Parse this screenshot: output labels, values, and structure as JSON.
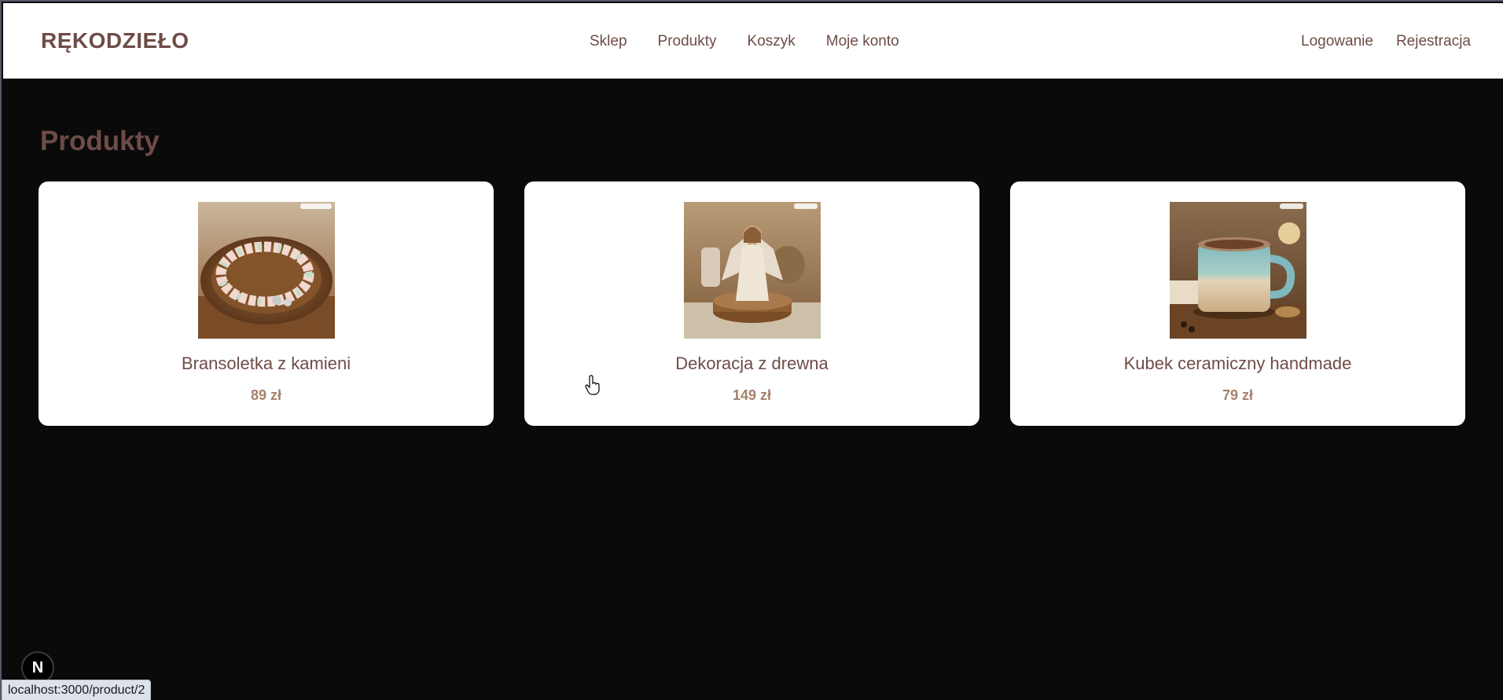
{
  "header": {
    "logo": "RĘKODZIEŁO",
    "nav": [
      "Sklep",
      "Produkty",
      "Koszyk",
      "Moje konto"
    ],
    "auth": [
      "Logowanie",
      "Rejestracja"
    ]
  },
  "main": {
    "title": "Produkty",
    "products": [
      {
        "name": "Bransoletka z kamieni",
        "price": "89 zł",
        "image": "bracelet-image"
      },
      {
        "name": "Dekoracja z drewna",
        "price": "149 zł",
        "image": "wooden-angel-image"
      },
      {
        "name": "Kubek ceramiczny handmade",
        "price": "79 zł",
        "image": "ceramic-mug-image"
      }
    ]
  },
  "overlay": {
    "next_badge": "N",
    "status_url": "localhost:3000/product/2"
  },
  "colors": {
    "brand": "#6e4c47",
    "price": "#a6806a",
    "background": "#0b0a0b",
    "card": "#ffffff"
  }
}
